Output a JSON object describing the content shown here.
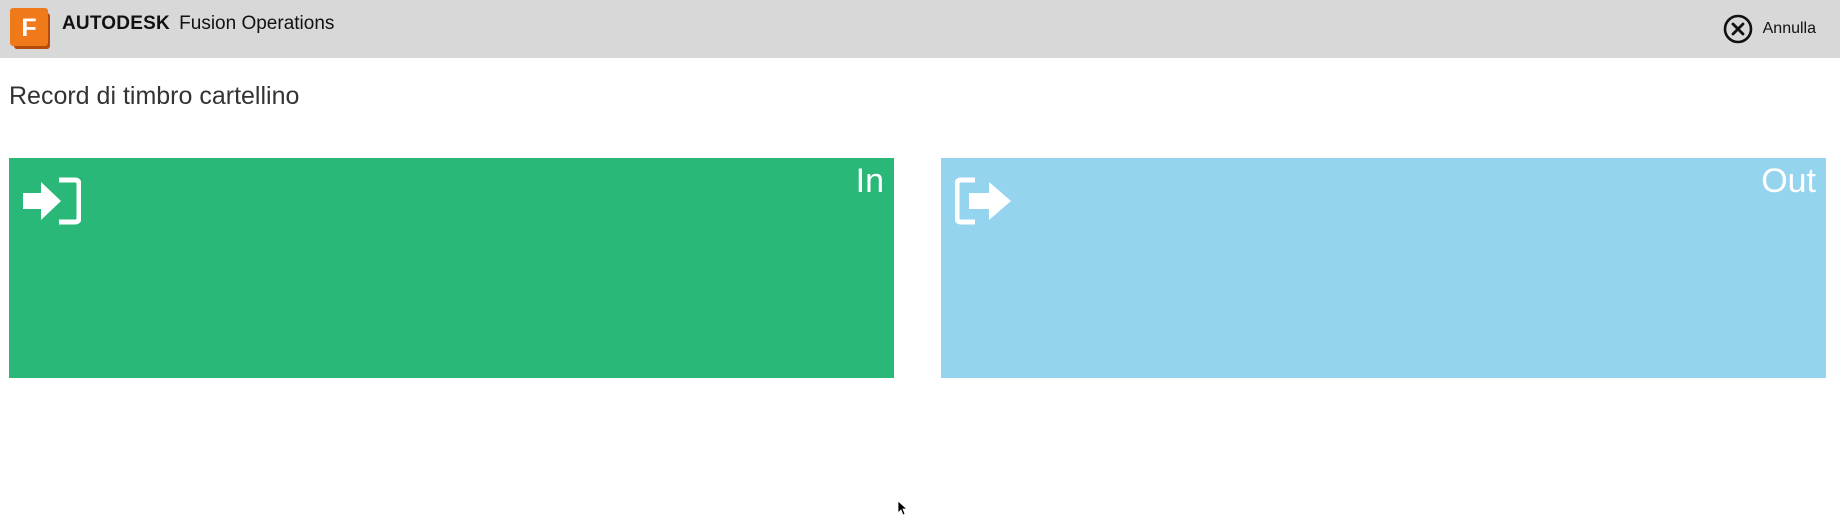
{
  "header": {
    "logo_letter": "F",
    "brand_bold": "AUTODESK",
    "brand_product": "Fusion Operations",
    "cancel_label": "Annulla",
    "logo_icon": "fusion-logo-icon",
    "cancel_icon": "close-circle-icon"
  },
  "page": {
    "title": "Record di timbro cartellino"
  },
  "tiles": [
    {
      "label": "In",
      "icon": "sign-in-icon",
      "color": "#2ab879"
    },
    {
      "label": "Out",
      "icon": "sign-out-icon",
      "color": "#95d4ef"
    }
  ],
  "colors": {
    "header_bg": "#d8d8d8",
    "logo_orange": "#f07a1a"
  }
}
